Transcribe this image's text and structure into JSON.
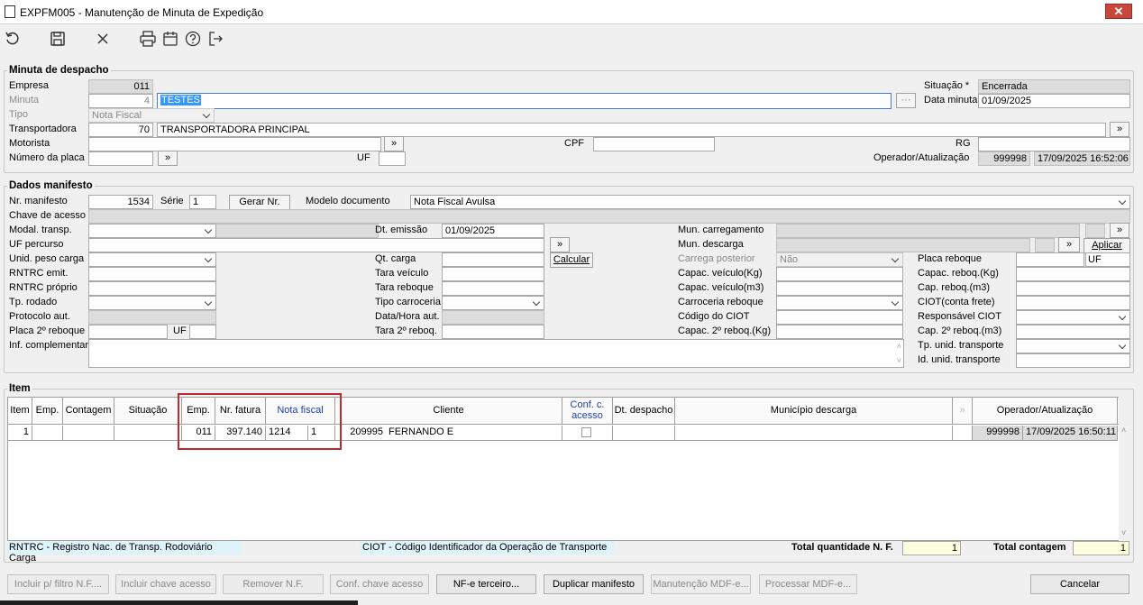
{
  "window": {
    "title": "EXPFM005 - Manutenção de Minuta de Expedição",
    "close_label": "✕"
  },
  "toolbar": {
    "icons": [
      "refresh-icon",
      "save-icon",
      "cancel-icon",
      "print-icon",
      "calendar-icon",
      "help-icon",
      "exit-icon"
    ]
  },
  "minuta": {
    "section_title": "Minuta de despacho",
    "empresa_label": "Empresa",
    "empresa_value": "011",
    "minuta_label": "Minuta",
    "minuta_number": "4",
    "minuta_desc": "TESTES",
    "tipo_label": "Tipo",
    "tipo_value": "Nota Fiscal",
    "transportadora_label": "Transportadora",
    "transportadora_code": "70",
    "transportadora_name": "TRANSPORTADORA PRINCIPAL",
    "motorista_label": "Motorista",
    "cpf_label": "CPF",
    "rg_label": "RG",
    "placa_label": "Número da placa",
    "uf_label": "UF",
    "situacao_label": "Situação *",
    "situacao_value": "Encerrada",
    "data_label": "Data minuta",
    "data_value": "01/09/2025",
    "operador_label": "Operador/Atualização",
    "operador_code": "999998",
    "operador_date": "17/09/2025 16:52:06"
  },
  "manifesto": {
    "section_title": "Dados manifesto",
    "nr_label": "Nr. manifesto",
    "nr_value": "1534",
    "serie_label": "Série",
    "serie_value": "1",
    "gerar_label": "Gerar Nr.",
    "modelo_label": "Modelo documento",
    "modelo_value": "Nota Fiscal Avulsa",
    "chave_label": "Chave de acesso",
    "modal_label": "Modal. transp.",
    "dt_emissao_label": "Dt. emissão",
    "dt_emissao_value": "01/09/2025",
    "uf_percurso_label": "UF percurso",
    "unid_peso_label": "Unid. peso carga",
    "rntrc_emit_label": "RNTRC emit.",
    "rntrc_proprio_label": "RNTRC próprio",
    "tp_rodado_label": "Tp. rodado",
    "protocolo_label": "Protocolo aut.",
    "placa2_label": "Placa 2º reboque",
    "uf_label": "UF",
    "inf_label": "Inf. complementar",
    "qt_carga_label": "Qt. carga",
    "tara_veiculo_label": "Tara veículo",
    "tara_reboque_label": "Tara reboque",
    "tipo_carroceria_label": "Tipo carroceria",
    "data_hora_label": "Data/Hora aut.",
    "tara2_label": "Tara 2º reboq.",
    "calcular_label": "Calcular",
    "mun_carreg_label": "Mun. carregamento",
    "mun_desc_label": "Mun. descarga",
    "carrega_post_label": "Carrega posterior",
    "carrega_post_value": "Não",
    "capac_kg_label": "Capac. veículo(Kg)",
    "capac_m3_label": "Capac. veículo(m3)",
    "carroceria_reb_label": "Carroceria reboque",
    "codigo_ciot_label": "Código do CIOT",
    "capac2_label": "Capac. 2º reboq.(Kg)",
    "aplicar_label": "Aplicar",
    "placa_reboque_label": "Placa reboque",
    "capac_reb_kg_label": "Capac. reboq.(Kg)",
    "cap_reb_m3_label": "Cap. reboq.(m3)",
    "ciot_frete_label": "CIOT(conta frete)",
    "resp_ciot_label": "Responsável CIOT",
    "cap2_m3_label": "Cap. 2º reboq.(m3)",
    "tp_unid_label": "Tp. unid. transporte",
    "id_unid_label": "Id. unid. transporte"
  },
  "item": {
    "section_title": "Item",
    "columns": [
      "Item",
      "Emp.",
      "Contagem",
      "Situação",
      "Emp.",
      "Nr. fatura",
      "Nota fiscal",
      "Cliente",
      "Conf. c. acesso",
      "Dt. despacho",
      "Município descarga",
      "Operador/Atualização"
    ],
    "row": {
      "item": "1",
      "emp": "011",
      "nr_fatura": "397.140",
      "nota_fiscal": "1214",
      "serie": "1",
      "cliente_code": "209995",
      "cliente_name": "FERNANDO E",
      "operador_code": "999998",
      "operador_date": "17/09/2025 16:50:11"
    },
    "legend_rntrc": "RNTRC - Registro Nac. de Transp. Rodoviário Carga",
    "legend_ciot": "CIOT - Código Identificador da Operação de Transporte",
    "total_nf_label": "Total quantidade N. F.",
    "total_nf_value": "1",
    "total_contagem_label": "Total contagem",
    "total_contagem_value": "1",
    "highlight_color": "#c0282d"
  },
  "buttons": {
    "incluir_filtro": "Incluir p/ filtro N.F....",
    "incluir_chave": "Incluir chave acesso",
    "remover": "Remover N.F.",
    "conf_chave": "Conf. chave acesso",
    "nfe_terceiro": "NF-e terceiro...",
    "duplicar": "Duplicar manifesto",
    "manutencao": "Manutenção MDF-e...",
    "processar": "Processar MDF-e...",
    "cancelar": "Cancelar"
  }
}
